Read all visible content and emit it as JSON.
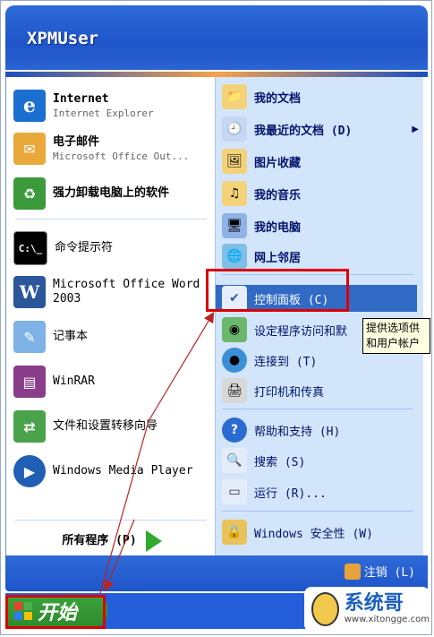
{
  "header": {
    "username": "XPMUser"
  },
  "left": {
    "pinned": [
      {
        "title": "Internet",
        "subtitle": "Internet Explorer",
        "icon": "ie-icon"
      },
      {
        "title": "电子邮件",
        "subtitle": "Microsoft Office Out...",
        "icon": "email-icon"
      }
    ],
    "items": [
      {
        "label": "强力卸载电脑上的软件",
        "icon": "uninstall-icon"
      },
      {
        "label": "命令提示符",
        "icon": "cmd-icon"
      },
      {
        "label": "Microsoft Office Word 2003",
        "icon": "word-icon"
      },
      {
        "label": "记事本",
        "icon": "notepad-icon"
      },
      {
        "label": "WinRAR",
        "icon": "winrar-icon"
      },
      {
        "label": "文件和设置转移向导",
        "icon": "transfer-wizard-icon"
      },
      {
        "label": "Windows Media Player",
        "icon": "media-player-icon"
      }
    ],
    "all_programs": "所有程序 (P)"
  },
  "right": {
    "items": [
      {
        "label": "我的文档"
      },
      {
        "label": "我最近的文档 (D)"
      },
      {
        "label": "图片收藏"
      },
      {
        "label": "我的音乐"
      },
      {
        "label": "我的电脑"
      },
      {
        "label": "网上邻居"
      },
      {
        "label": "控制面板 (C)"
      },
      {
        "label": "设定程序访问和默"
      },
      {
        "label": "连接到 (T)"
      },
      {
        "label": "打印机和传真"
      },
      {
        "label": "帮助和支持 (H)"
      },
      {
        "label": "搜索 (S)"
      },
      {
        "label": "运行 (R)..."
      },
      {
        "label": "Windows 安全性 (W)"
      }
    ]
  },
  "tooltip": {
    "line1": "提供选项供",
    "line2": "和用户帐户"
  },
  "footer": {
    "logout": "注销 (L)"
  },
  "taskbar": {
    "start": "开始"
  },
  "watermark": {
    "title": "系统哥",
    "url": "www.xitongge.com"
  }
}
